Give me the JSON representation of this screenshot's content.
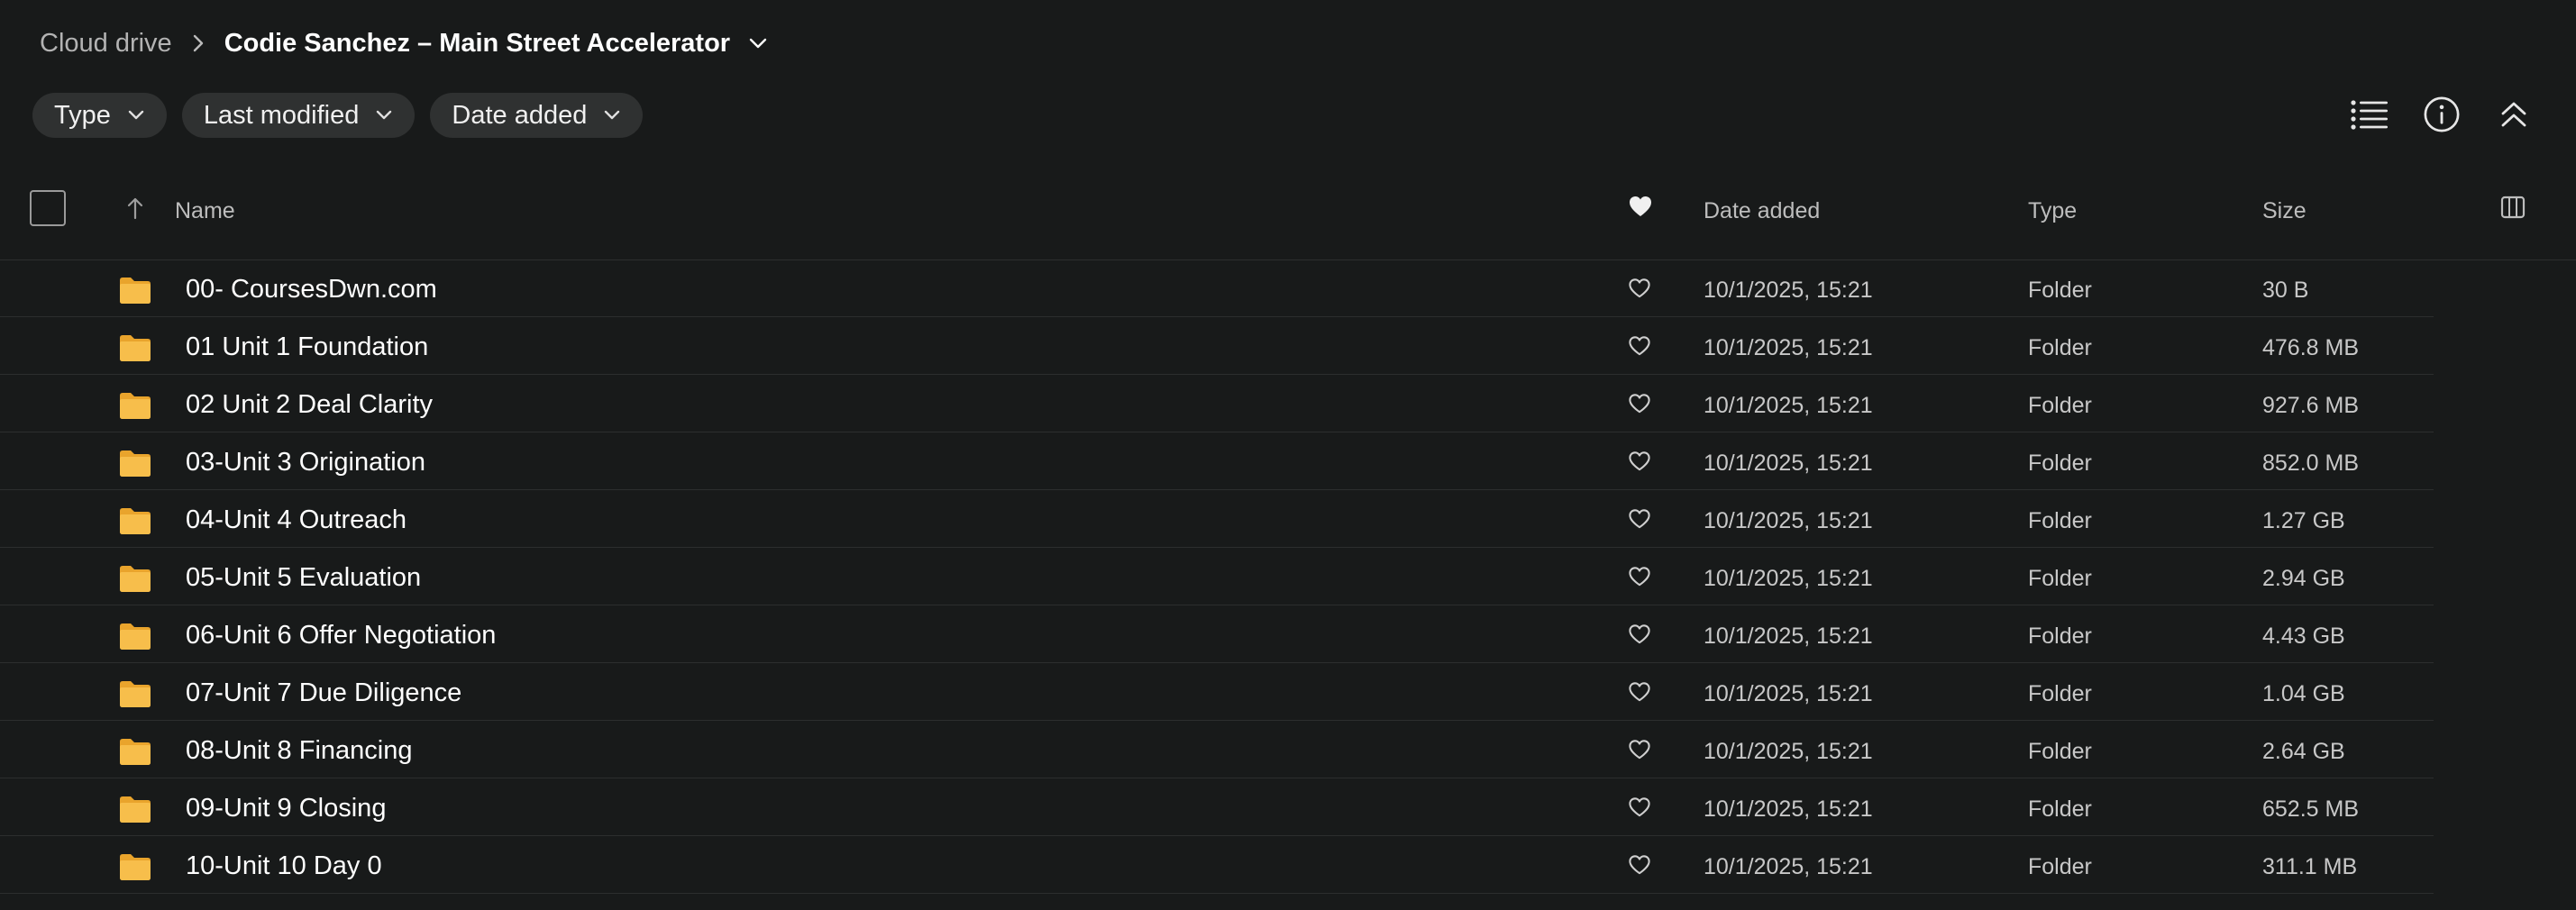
{
  "breadcrumb": {
    "root": "Cloud drive",
    "current": "Codie Sanchez – Main Street Accelerator"
  },
  "filters": [
    {
      "label": "Type"
    },
    {
      "label": "Last modified"
    },
    {
      "label": "Date added"
    }
  ],
  "columns": {
    "name": "Name",
    "date_added": "Date added",
    "type": "Type",
    "size": "Size"
  },
  "rows": [
    {
      "name": "00- CoursesDwn.com",
      "date": "10/1/2025, 15:21",
      "type": "Folder",
      "size": "30 B"
    },
    {
      "name": "01 Unit 1 Foundation",
      "date": "10/1/2025, 15:21",
      "type": "Folder",
      "size": "476.8 MB"
    },
    {
      "name": "02 Unit 2 Deal Clarity",
      "date": "10/1/2025, 15:21",
      "type": "Folder",
      "size": "927.6 MB"
    },
    {
      "name": "03-Unit 3 Origination",
      "date": "10/1/2025, 15:21",
      "type": "Folder",
      "size": "852.0 MB"
    },
    {
      "name": "04-Unit 4 Outreach",
      "date": "10/1/2025, 15:21",
      "type": "Folder",
      "size": "1.27 GB"
    },
    {
      "name": "05-Unit 5 Evaluation",
      "date": "10/1/2025, 15:21",
      "type": "Folder",
      "size": "2.94 GB"
    },
    {
      "name": "06-Unit 6 Offer Negotiation",
      "date": "10/1/2025, 15:21",
      "type": "Folder",
      "size": "4.43 GB"
    },
    {
      "name": "07-Unit 7 Due Diligence",
      "date": "10/1/2025, 15:21",
      "type": "Folder",
      "size": "1.04 GB"
    },
    {
      "name": "08-Unit 8 Financing",
      "date": "10/1/2025, 15:21",
      "type": "Folder",
      "size": "2.64 GB"
    },
    {
      "name": "09-Unit 9 Closing",
      "date": "10/1/2025, 15:21",
      "type": "Folder",
      "size": "652.5 MB"
    },
    {
      "name": "10-Unit 10 Day 0",
      "date": "10/1/2025, 15:21",
      "type": "Folder",
      "size": "311.1 MB"
    }
  ],
  "icons": {
    "folder": "folder-icon",
    "favorite": "heart-icon",
    "list_view": "list-view-icon",
    "info": "info-icon",
    "collapse": "double-chevron-up-icon",
    "columns": "columns-icon"
  },
  "colors": {
    "background": "#181a1a",
    "chip": "#2f3131",
    "folder": "#f5b53d"
  }
}
